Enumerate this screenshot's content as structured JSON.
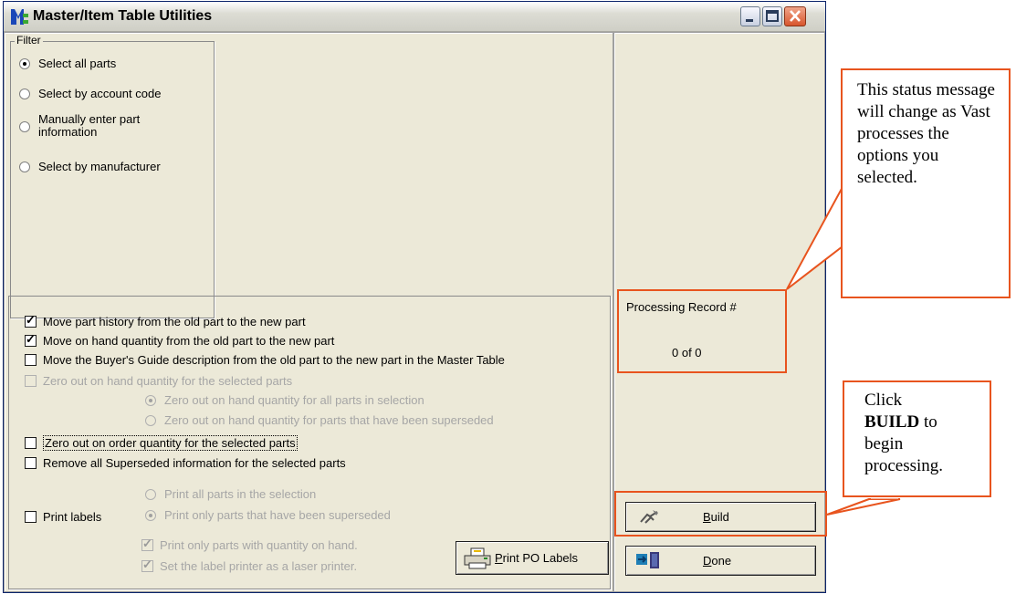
{
  "window": {
    "title": "Master/Item Table Utilities",
    "controls": {
      "minimize": "minimize-icon",
      "maximize": "maximize-icon",
      "close": "close-icon"
    }
  },
  "filter": {
    "legend": "Filter",
    "options": [
      {
        "label": "Select all parts",
        "checked": true
      },
      {
        "label": "Select by account code",
        "checked": false
      },
      {
        "label": "Manually enter part information",
        "checked": false
      },
      {
        "label": "Select by manufacturer",
        "checked": false
      }
    ]
  },
  "options": {
    "move_history": {
      "label": "Move part history from the old part to the new part",
      "checked": true
    },
    "move_on_hand": {
      "label": "Move on hand quantity from the old part to the new part",
      "checked": true
    },
    "move_buyers_guide": {
      "label": "Move the Buyer's Guide description from the old part to the new part in the Master Table",
      "checked": false
    },
    "zero_on_hand": {
      "label": "Zero out on hand quantity for the selected parts",
      "checked": false,
      "disabled": true
    },
    "zero_on_hand_all": {
      "label": "Zero out on hand quantity for all parts in selection",
      "checked": true,
      "disabled": true
    },
    "zero_on_hand_superseded": {
      "label": "Zero out on hand quantity for parts that have been superseded",
      "checked": false,
      "disabled": true
    },
    "zero_on_order": {
      "label": "Zero out on order quantity for the selected parts",
      "checked": false
    },
    "remove_superseded": {
      "label": "Remove all Superseded information for the selected parts",
      "checked": false
    },
    "print_labels": {
      "label": "Print labels",
      "checked": false
    },
    "print_all": {
      "label": "Print all parts in the selection",
      "checked": false,
      "disabled": true
    },
    "print_superseded": {
      "label": "Print only parts that have been superseded",
      "checked": true,
      "disabled": true
    },
    "print_with_qty": {
      "label": "Print only parts with quantity on hand.",
      "checked": true,
      "disabled": true
    },
    "laser_printer": {
      "label": "Set the label printer as a laser printer.",
      "checked": true,
      "disabled": true
    }
  },
  "buttons": {
    "print_po_labels": {
      "label": "Print PO Labels",
      "accel": "P",
      "rest": "rint PO Labels"
    },
    "build": {
      "label": "Build",
      "accel": "B",
      "rest": "uild"
    },
    "done": {
      "label": "Done",
      "accel": "D",
      "rest": "one"
    }
  },
  "status": {
    "label": "Processing Record #",
    "value": "0  of 0"
  },
  "annotations": {
    "status_note": "This status message will change as Vast processes the options you selected.",
    "build_note_prefix": "Click",
    "build_note_bold": "BUILD",
    "build_note_suffix": "to begin processing."
  },
  "colors": {
    "callout": "#e8541e",
    "window_bg": "#ece9d8",
    "disabled_text": "#a6a6a6"
  }
}
